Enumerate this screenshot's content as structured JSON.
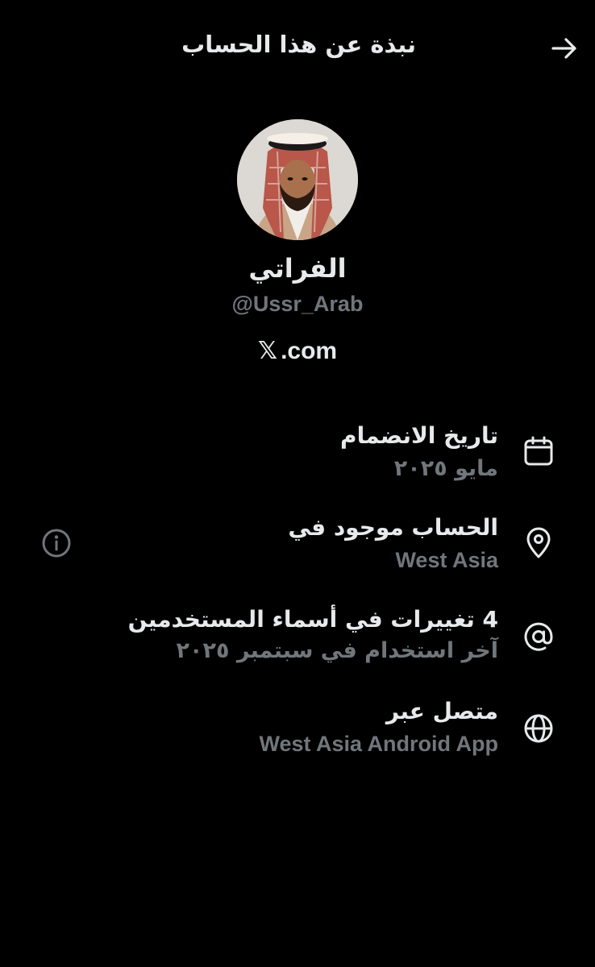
{
  "header": {
    "title": "نبذة عن هذا الحساب",
    "back_icon": "arrow-right-icon"
  },
  "profile": {
    "display_name": "الفراتي",
    "handle": "@Ussr_Arab",
    "site_logo": "𝕏",
    "site_domain": ".com"
  },
  "details": [
    {
      "icon": "calendar-icon",
      "title": "تاريخ الانضمام",
      "subtitle": "مايو ٢٠٢٥"
    },
    {
      "icon": "location-pin-icon",
      "title": "الحساب موجود في",
      "subtitle": "West Asia",
      "action_icon": "info-icon"
    },
    {
      "icon": "at-sign-icon",
      "title": "4 تغييرات في أسماء المستخدمين",
      "subtitle": "آخر استخدام في سبتمبر ٢٠٢٥"
    },
    {
      "icon": "globe-icon",
      "title": "متصل عبر",
      "subtitle": "West Asia Android App"
    }
  ],
  "colors": {
    "background": "#000000",
    "primary_text": "#e7e9ea",
    "secondary_text": "#71767b"
  }
}
